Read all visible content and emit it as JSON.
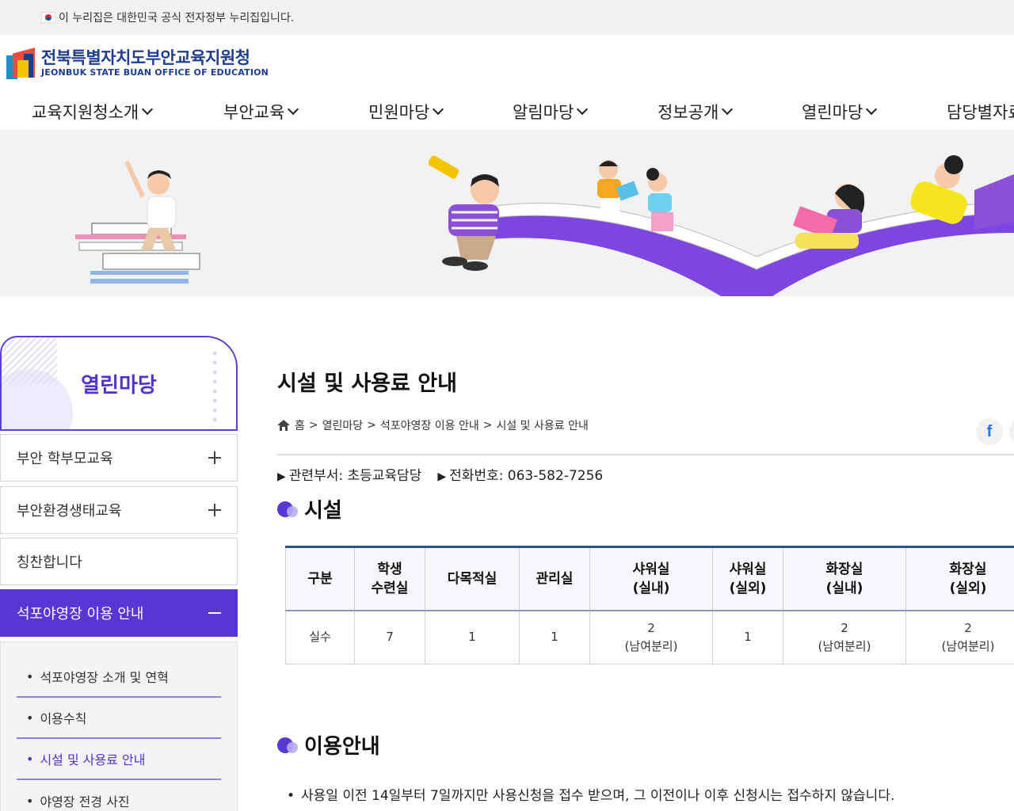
{
  "gov_bar": {
    "text": "이 누리집은 대한민국 공식 전자정부 누리집입니다."
  },
  "logo": {
    "name_ko": "전북특별자치도부안교육지원청",
    "name_en": "JEONBUK STATE BUAN OFFICE OF EDUCATION"
  },
  "gnb": [
    {
      "label": "교육지원청소개"
    },
    {
      "label": "부안교육"
    },
    {
      "label": "민원마당"
    },
    {
      "label": "알림마당"
    },
    {
      "label": "정보공개"
    },
    {
      "label": "열린마당"
    },
    {
      "label": "담당별자료"
    }
  ],
  "side": {
    "title": "열린마당",
    "items": [
      {
        "label": "부안 학부모교육"
      },
      {
        "label": "부안환경생태교육"
      },
      {
        "label": "칭찬합니다"
      },
      {
        "label": "석포야영장 이용 안내"
      }
    ],
    "sub_items": [
      {
        "label": "석포야영장 소개 및 연혁"
      },
      {
        "label": "이용수칙"
      },
      {
        "label": "시설 및 사용료 안내"
      },
      {
        "label": "야영장 전경 사진"
      }
    ]
  },
  "content": {
    "title": "시설 및 사용료 안내",
    "breadcrumb": [
      "홈",
      "열린마당",
      "석포야영장 이용 안내",
      "시설 및 사용료 안내"
    ],
    "breadcrumb_sep": ">",
    "dept": "관련부서: 초등교육담당",
    "phone": "전화번호: 063-582-7256",
    "facility_title": "시설",
    "facility_table": {
      "headers": [
        "구분",
        "학생\n수련실",
        "다목적실",
        "관리실",
        "샤워실\n(실내)",
        "샤워실\n(실외)",
        "화장실\n(실내)",
        "화장실\n(실외)"
      ],
      "row": [
        "실수",
        "7",
        "1",
        "1",
        "2\n(남여분리)",
        "1",
        "2\n(남여분리)",
        "2\n(남여분리)"
      ]
    },
    "usage_title": "이용안내",
    "usage_notice": "사용일 이전 14일부터 7일까지만 사용신청을 접수 받으며, 그 이전이나 이후 신청시는 접수하지 않습니다."
  },
  "share": {
    "icon": "facebook-icon"
  },
  "colors": {
    "accent": "#5637d6",
    "brand": "#1f3c8f",
    "banner_purple": "#7e46e0"
  }
}
